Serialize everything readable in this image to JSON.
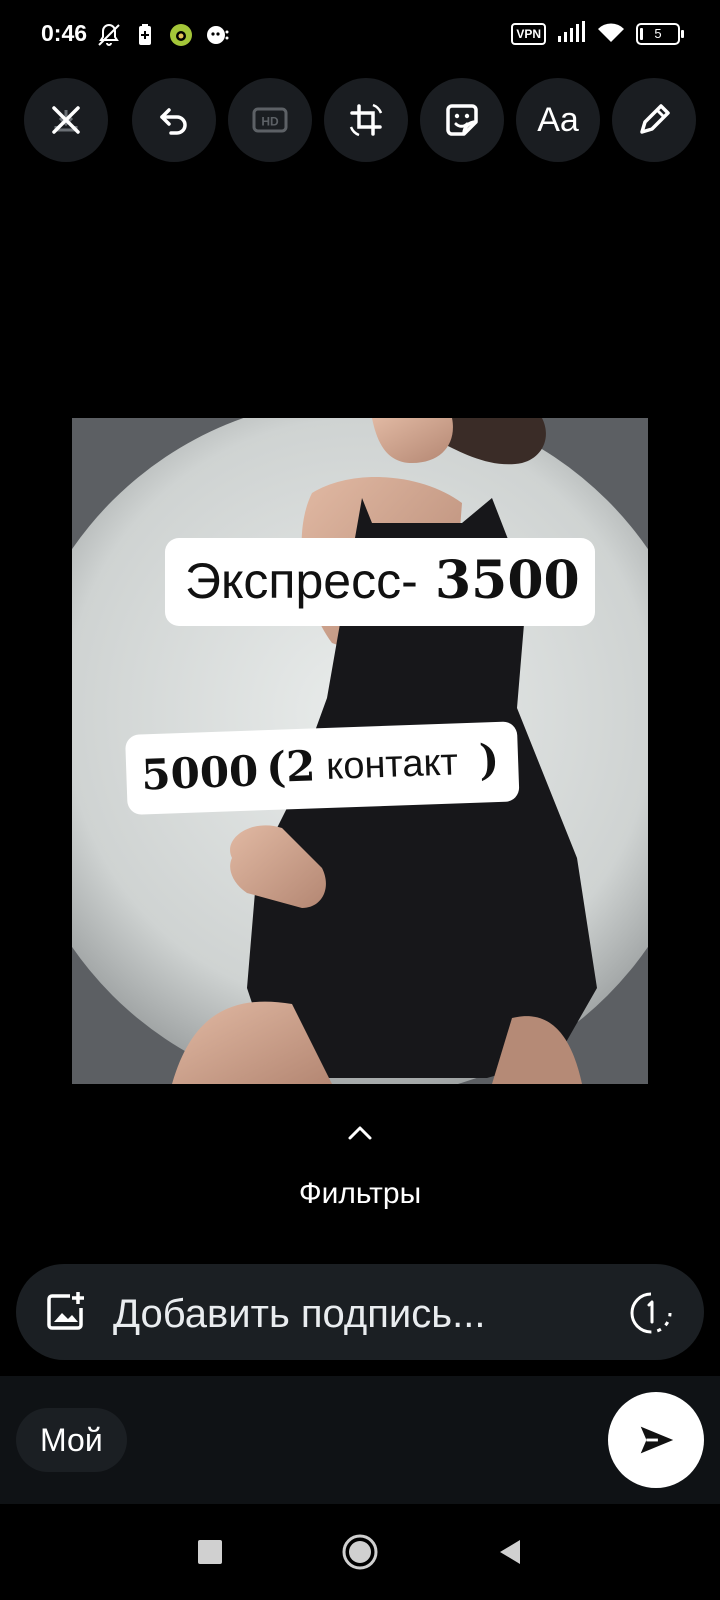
{
  "status_bar": {
    "time": "0:46",
    "left_icons": [
      "bell-off-icon",
      "battery-saver-icon",
      "app-icon",
      "assistant-icon"
    ],
    "vpn_label": "VPN",
    "battery_level": "5",
    "right_icons": [
      "signal-icon",
      "wifi-icon"
    ]
  },
  "toolbar": {
    "buttons": [
      "close-download",
      "undo",
      "hd",
      "crop-rotate",
      "sticker",
      "text",
      "draw"
    ],
    "hd_label": "HD",
    "text_label": "Aa"
  },
  "photo": {
    "sticker_1": {
      "label": "Экспресс-",
      "price": "3500"
    },
    "sticker_2": {
      "price": "5000",
      "paren_num": "(2",
      "text": "контакт",
      "close_paren": ")"
    }
  },
  "filters": {
    "label": "Фильтры"
  },
  "caption": {
    "placeholder": "Добавить подпись..."
  },
  "bottom": {
    "chip_label": "Мой"
  }
}
